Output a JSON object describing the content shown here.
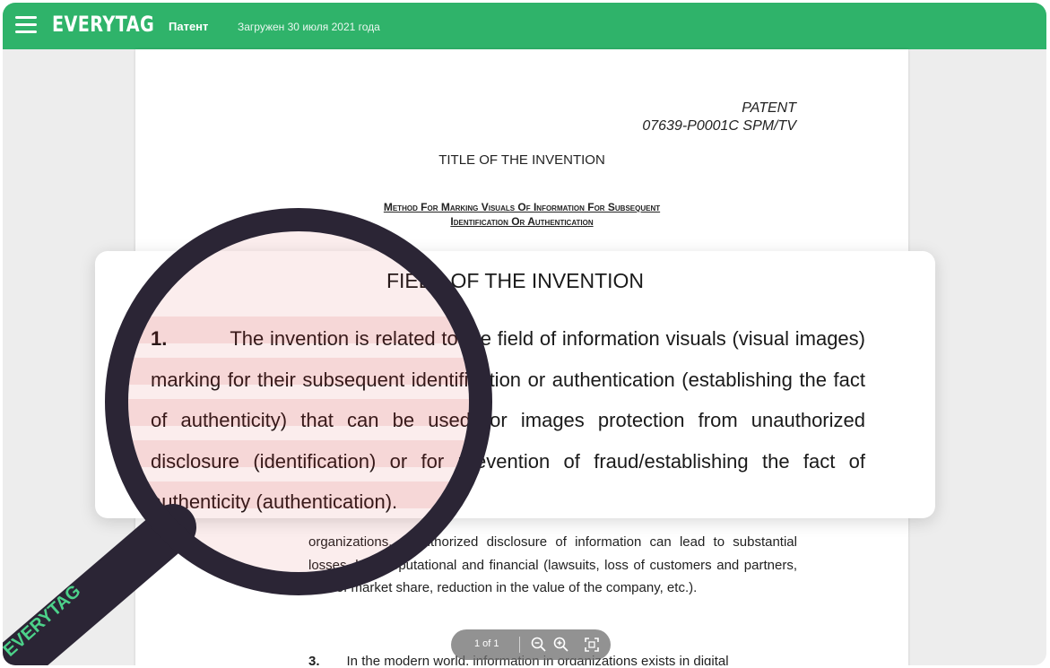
{
  "header": {
    "logo": "EVERYTAG",
    "doc_type": "Патент",
    "upload_date": "Загружен 30 июля 2021 года"
  },
  "document": {
    "patent_label": "PATENT",
    "patent_number": "07639-P0001C SPM/TV",
    "title_heading": "TITLE OF THE INVENTION",
    "invention_title_line1": "Method For Marking Visuals Of Information For Subsequent",
    "invention_title_line2": "Identification Or Authentication",
    "para2_text": "organizations, unauthorized disclosure of information can lead to substantial losses, both reputational and financial (lawsuits, loss of customers and partners, loss of market share, reduction in the value of the company, etc.).",
    "para3_number": "3.",
    "para3_text": "In the modern world, information in organizations exists in digital"
  },
  "zoom": {
    "heading": "FIELD OF THE INVENTION",
    "para_number": "1.",
    "para_text": "The invention is related to the field of information visuals (visual images) marking for their subsequent identification or authentication (establishing the fact of authenticity) that can be used for images protection from unauthorized disclosure (identification) or for prevention of fraud/establishing the fact of authenticity (authentication)."
  },
  "magnifier": {
    "handle_logo": "EVERYTAG"
  },
  "toolbar": {
    "page_indicator": "1 of 1"
  },
  "colors": {
    "brand_green": "#2fb36a",
    "magnifier_ring": "#2b2535",
    "highlight_red": "#d11a1a"
  }
}
